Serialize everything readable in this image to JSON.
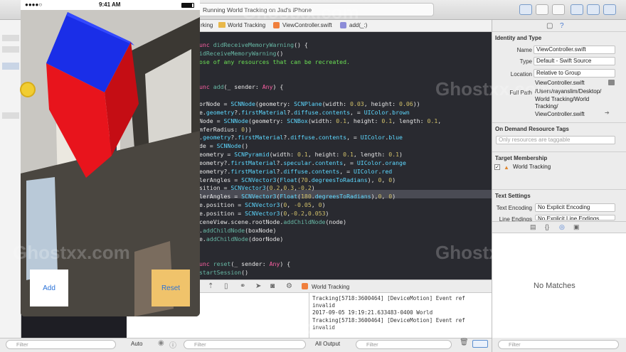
{
  "toolbar": {
    "status": "Running World Tracking on Jad's iPhone"
  },
  "phone": {
    "carrier": "●●●●○ ",
    "time": "9:41 AM",
    "battery_icon": "battery-icon",
    "add_button": "Add",
    "reset_button": "Reset"
  },
  "jumpbar": {
    "items": [
      "rking",
      "World Tracking",
      "ViewController.swift",
      "add(_:)"
    ]
  },
  "code_lines": [
    [
      [
        "kw",
        "unc "
      ],
      [
        "fn",
        "didReceiveMemoryWarning"
      ],
      [
        "",
        "() {"
      ]
    ],
    [
      [
        "fn",
        "idReceiveMemoryWarning"
      ],
      [
        "",
        "()"
      ]
    ],
    [
      [
        "cm",
        "ose of any resources that can be recreated."
      ]
    ],
    [
      [
        "",
        ""
      ]
    ],
    [
      [
        "",
        ""
      ]
    ],
    [
      [
        "kw",
        "unc "
      ],
      [
        "fn",
        "add"
      ],
      [
        "",
        "(_ sender: "
      ],
      [
        "kw",
        "Any"
      ],
      [
        "",
        ") {"
      ]
    ],
    [
      [
        "",
        ""
      ]
    ],
    [
      [
        "",
        "orNode = "
      ],
      [
        "ty",
        "SCNNode"
      ],
      [
        "",
        "(geometry: "
      ],
      [
        "ty",
        "SCNPlane"
      ],
      [
        "",
        "(width: "
      ],
      [
        "num",
        "0.03"
      ],
      [
        "",
        ", height: "
      ],
      [
        "num",
        "0.06"
      ],
      [
        "",
        "))"
      ]
    ],
    [
      [
        "",
        "e."
      ],
      [
        "ty",
        "geometry"
      ],
      [
        "",
        "?."
      ],
      [
        "ty",
        "firstMaterial"
      ],
      [
        "",
        "?."
      ],
      [
        "ty",
        "diffuse"
      ],
      [
        "",
        "."
      ],
      [
        "ty",
        "contents"
      ],
      [
        "",
        ", = "
      ],
      [
        "ty",
        "UIColor"
      ],
      [
        "",
        "."
      ],
      [
        "ty",
        "brown"
      ]
    ],
    [
      [
        "",
        "Node = "
      ],
      [
        "ty",
        "SCNNode"
      ],
      [
        "",
        "(geometry: "
      ],
      [
        "ty",
        "SCNBox"
      ],
      [
        "",
        "(width: "
      ],
      [
        "num",
        "0.1"
      ],
      [
        "",
        ", height: "
      ],
      [
        "num",
        "0.1"
      ],
      [
        "",
        ", length: "
      ],
      [
        "num",
        "0.1"
      ],
      [
        "",
        ","
      ]
    ],
    [
      [
        "",
        "mferRadius: "
      ],
      [
        "num",
        "0"
      ],
      [
        "",
        "))"
      ]
    ],
    [
      [
        "",
        "."
      ],
      [
        "ty",
        "geometry"
      ],
      [
        "",
        "?."
      ],
      [
        "ty",
        "firstMaterial"
      ],
      [
        "",
        "?."
      ],
      [
        "ty",
        "diffuse"
      ],
      [
        "",
        "."
      ],
      [
        "ty",
        "contents"
      ],
      [
        "",
        ", = "
      ],
      [
        "ty",
        "UIColor"
      ],
      [
        "",
        "."
      ],
      [
        "ty",
        "blue"
      ]
    ],
    [
      [
        "",
        "de = "
      ],
      [
        "ty",
        "SCNNode"
      ],
      [
        "",
        "()"
      ]
    ],
    [
      [
        "",
        "eometry = "
      ],
      [
        "ty",
        "SCNPyramid"
      ],
      [
        "",
        "(width: "
      ],
      [
        "num",
        "0.1"
      ],
      [
        "",
        ", height: "
      ],
      [
        "num",
        "0.1"
      ],
      [
        "",
        ", length: "
      ],
      [
        "num",
        "0.1"
      ],
      [
        "",
        ")"
      ]
    ],
    [
      [
        "",
        "eometry?."
      ],
      [
        "ty",
        "firstMaterial"
      ],
      [
        "",
        "?."
      ],
      [
        "ty",
        "specular"
      ],
      [
        "",
        "."
      ],
      [
        "ty",
        "contents"
      ],
      [
        "",
        ", = "
      ],
      [
        "ty",
        "UIColor"
      ],
      [
        "",
        "."
      ],
      [
        "ty",
        "orange"
      ]
    ],
    [
      [
        "",
        "eometry?."
      ],
      [
        "ty",
        "firstMaterial"
      ],
      [
        "",
        "?."
      ],
      [
        "ty",
        "diffuse"
      ],
      [
        "",
        "."
      ],
      [
        "ty",
        "contents"
      ],
      [
        "",
        ", = "
      ],
      [
        "ty",
        "UIColor"
      ],
      [
        "",
        "."
      ],
      [
        "ty",
        "red"
      ]
    ],
    [
      [
        "",
        "lerAngles = "
      ],
      [
        "ty",
        "SCNVector3"
      ],
      [
        "",
        "("
      ],
      [
        "ty",
        "Float"
      ],
      [
        "",
        "("
      ],
      [
        "num",
        "70"
      ],
      [
        "",
        "."
      ],
      [
        "ty",
        "degreesToRadians"
      ],
      [
        "",
        "), "
      ],
      [
        "num",
        "0"
      ],
      [
        "",
        ", "
      ],
      [
        "num",
        "0"
      ],
      [
        "",
        ")"
      ]
    ],
    [
      [
        "",
        "sition = "
      ],
      [
        "ty",
        "SCNVector3"
      ],
      [
        "",
        "("
      ],
      [
        "num",
        "0.2"
      ],
      [
        "",
        ","
      ],
      [
        "num",
        "0.3"
      ],
      [
        "",
        ","
      ],
      [
        "num",
        "-0.2"
      ],
      [
        "",
        ")"
      ]
    ],
    [
      [
        "",
        "lerAngles = "
      ],
      [
        "ty",
        "SCNVector3"
      ],
      [
        "",
        "("
      ],
      [
        "ty",
        "Float"
      ],
      [
        "",
        "("
      ],
      [
        "num",
        "180"
      ],
      [
        "",
        "."
      ],
      [
        "ty",
        "degreesToRadians"
      ],
      [
        "",
        "),"
      ],
      [
        "num",
        "0"
      ],
      [
        "",
        ", "
      ],
      [
        "num",
        "0"
      ],
      [
        "",
        ")"
      ]
    ],
    [
      [
        "",
        "e.position = "
      ],
      [
        "ty",
        "SCNVector3"
      ],
      [
        "",
        "("
      ],
      [
        "num",
        "0"
      ],
      [
        "",
        ", "
      ],
      [
        "num",
        "-0.05"
      ],
      [
        "",
        ", "
      ],
      [
        "num",
        "0"
      ],
      [
        "",
        ")"
      ]
    ],
    [
      [
        "",
        "e.position = "
      ],
      [
        "ty",
        "SCNVector3"
      ],
      [
        "",
        "("
      ],
      [
        "num",
        "0"
      ],
      [
        "",
        ","
      ],
      [
        "num",
        "-0.2"
      ],
      [
        "",
        ","
      ],
      [
        "num",
        "0.053"
      ],
      [
        "",
        ")"
      ]
    ],
    [
      [
        "",
        "ceneView.scene.rootNode."
      ],
      [
        "fn",
        "addChildNode"
      ],
      [
        "",
        "(node)"
      ]
    ],
    [
      [
        "",
        "."
      ],
      [
        "fn",
        "addChildNode"
      ],
      [
        "",
        "(boxNode)"
      ]
    ],
    [
      [
        "",
        "e."
      ],
      [
        "fn",
        "addChildNode"
      ],
      [
        "",
        "(doorNode)"
      ]
    ],
    [
      [
        "",
        ""
      ]
    ],
    [
      [
        "",
        ""
      ]
    ],
    [
      [
        "kw",
        "unc "
      ],
      [
        "fn",
        "reset"
      ],
      [
        "",
        "(_ sender: "
      ],
      [
        "kw",
        "Any"
      ],
      [
        "",
        ") {"
      ]
    ],
    [
      [
        "fn",
        "startSession"
      ],
      [
        "",
        "()"
      ]
    ]
  ],
  "debug": {
    "target": "World Tracking",
    "console": "Tracking[5718:3600464] [DeviceMotion] Event ref\ninvalid\n2017-09-05 19:19:21.633483-0400 World\nTracking[5718:3600464] [DeviceMotion] Event ref\ninvalid",
    "output_select": "All Output",
    "auto_select": "Auto"
  },
  "bottom": {
    "filter_left": "Filter",
    "filter_mid": "Filter",
    "filter_console": "Filter",
    "filter_right": "Filter"
  },
  "inspector": {
    "identity_title": "Identity and Type",
    "name_label": "Name",
    "name_value": "ViewController.swift",
    "type_label": "Type",
    "type_value": "Default - Swift Source",
    "location_label": "Location",
    "location_value": "Relative to Group",
    "location_file": "ViewController.swift",
    "fullpath_label": "Full Path",
    "fullpath_value": "/Users/rayanslim/Desktop/\nWorld Tracking/World\nTracking/\nViewController.swift",
    "odr_title": "On Demand Resource Tags",
    "odr_placeholder": "Only resources are taggable",
    "target_title": "Target Membership",
    "target_item": "World Tracking",
    "text_title": "Text Settings",
    "encoding_label": "Text Encoding",
    "encoding_value": "No Explicit Encoding",
    "endings_label": "Line Endings",
    "endings_value": "No Explicit Line Endings",
    "no_matches": "No Matches"
  },
  "watermark": "Ghostxx.com"
}
